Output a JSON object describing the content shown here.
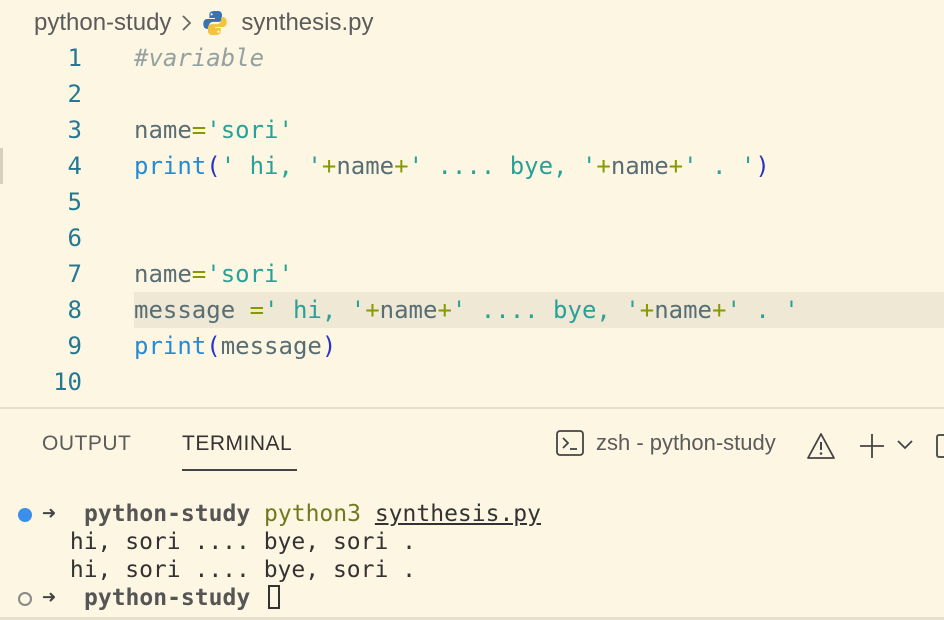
{
  "breadcrumb": {
    "folder": "python-study",
    "file": "synthesis.py"
  },
  "editor": {
    "line_numbers": [
      "1",
      "2",
      "3",
      "4",
      "5",
      "6",
      "7",
      "8",
      "9",
      "10"
    ],
    "current_line": 8,
    "lines": [
      [
        {
          "t": "#variable",
          "c": "cm"
        }
      ],
      [],
      [
        {
          "t": "name",
          "c": "id"
        },
        {
          "t": "=",
          "c": "op"
        },
        {
          "t": "'sori'",
          "c": "str"
        }
      ],
      [
        {
          "t": "print",
          "c": "fn"
        },
        {
          "t": "(",
          "c": "br"
        },
        {
          "t": "' hi, '",
          "c": "str"
        },
        {
          "t": "+",
          "c": "op"
        },
        {
          "t": "name",
          "c": "id"
        },
        {
          "t": "+",
          "c": "op"
        },
        {
          "t": "' .... bye, '",
          "c": "str"
        },
        {
          "t": "+",
          "c": "op"
        },
        {
          "t": "name",
          "c": "id"
        },
        {
          "t": "+",
          "c": "op"
        },
        {
          "t": "' . '",
          "c": "str"
        },
        {
          "t": ")",
          "c": "br"
        }
      ],
      [],
      [],
      [
        {
          "t": "name",
          "c": "id"
        },
        {
          "t": "=",
          "c": "op"
        },
        {
          "t": "'sori'",
          "c": "str"
        }
      ],
      [
        {
          "t": "message ",
          "c": "id"
        },
        {
          "t": "=",
          "c": "op"
        },
        {
          "t": "' hi, '",
          "c": "str"
        },
        {
          "t": "+",
          "c": "op"
        },
        {
          "t": "name",
          "c": "id"
        },
        {
          "t": "+",
          "c": "op"
        },
        {
          "t": "' .... bye, '",
          "c": "str"
        },
        {
          "t": "+",
          "c": "op"
        },
        {
          "t": "name",
          "c": "id"
        },
        {
          "t": "+",
          "c": "op"
        },
        {
          "t": "' . '",
          "c": "str"
        }
      ],
      [
        {
          "t": "print",
          "c": "fn"
        },
        {
          "t": "(",
          "c": "br"
        },
        {
          "t": "message",
          "c": "id"
        },
        {
          "t": ")",
          "c": "br"
        }
      ],
      []
    ]
  },
  "panel": {
    "tabs": [
      {
        "label": "OUTPUT",
        "active": false
      },
      {
        "label": "TERMINAL",
        "active": true
      }
    ],
    "terminal_name": "zsh - python-study",
    "icons": [
      "terminal-icon",
      "warning-icon",
      "plus-icon",
      "chevron-down-icon",
      "split-icon"
    ]
  },
  "terminal": {
    "prompt_arrow": "➜",
    "cwd": "python-study",
    "command": "python3",
    "argument": "synthesis.py",
    "output": [
      " hi, sori .... bye, sori .",
      " hi, sori .... bye, sori ."
    ]
  },
  "colors": {
    "background": "#fdf6e3",
    "current_line": "#eee8d5",
    "string": "#2aa198",
    "function": "#268bd2",
    "operator": "#859900",
    "line_number": "#237893"
  }
}
